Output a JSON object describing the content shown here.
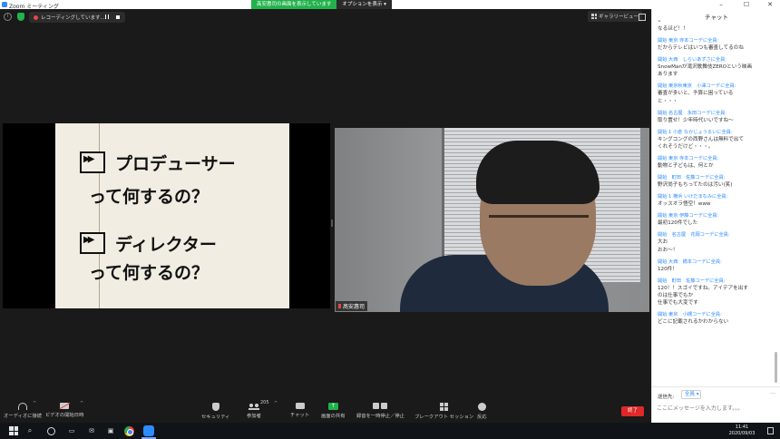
{
  "window": {
    "title": "Zoom ミーティング",
    "minimize": "–",
    "maximize": "☐",
    "close": "✕"
  },
  "share_banner": {
    "status": "髙安惠司の画面を表示しています",
    "view_options": "オプションを表示 ▾"
  },
  "meeting_top": {
    "info_icon": "i",
    "recording_text": "レコーディングしています...",
    "gallery_view": "ギャラリービュー"
  },
  "slide": {
    "heading1": "プロデューサー",
    "sub1": "って何するの？",
    "heading2": "ディレクター",
    "sub2": "って何するの？"
  },
  "participant": {
    "name": "髙安惠司"
  },
  "toolbar": {
    "audio": "オーディオに接続",
    "video": "ビデオの開始日時",
    "security": "セキュリティ",
    "participants": "参加者",
    "participants_count": "205",
    "chat": "チャット",
    "share": "画面の共有",
    "record": "録音を一時停止／停止",
    "breakout": "ブレークアウト セッション",
    "reactions": "反応",
    "end": "終了"
  },
  "chat": {
    "title": "チャット",
    "collapse": "⌄",
    "messages": [
      {
        "sender": "",
        "lines": [
          "なるほど！！"
        ]
      },
      {
        "sender": "開始 東京 寺本コーデに全員:",
        "lines": [
          "だからテレビはいつも審査してるのね"
        ]
      },
      {
        "sender": "開始 大西　しらいあずさに全員:",
        "lines": [
          "SnowManが滝沢歌舞伎ZEROという映画",
          "あります"
        ]
      },
      {
        "sender": "開始 東京秋東京　小澤コーデに全員:",
        "lines": [
          "審査が多いと、予算に困っている",
          "と・・・"
        ]
      },
      {
        "sender": "開始 名古屋　永田コーデに全員:",
        "lines": [
          "取り置せ！少年時代いいですね〜"
        ]
      },
      {
        "sender": "開始 1 小倉 なかじょうるいに全員:",
        "lines": [
          "キングコングの西野さんは無料で出て",
          "くれそうだけど・・・。"
        ]
      },
      {
        "sender": "開始 東京 寺本コーデに全員:",
        "lines": [
          "動物と子どもは、何とか"
        ]
      },
      {
        "sender": "開始　町田　佐藤コーデに全員:",
        "lines": [
          "野沢尚子もちってたのは汚い(笑)"
        ]
      },
      {
        "sender": "開始 1 横浜 いけだまなみに全員:",
        "lines": [
          "オッスオラ悟空！www"
        ]
      },
      {
        "sender": "開始 東京 伊藤コーデに全員:",
        "lines": [
          "最初120件でした"
        ]
      },
      {
        "sender": "開始　名古屋　花岡コーデに全員:",
        "lines": [
          "大お",
          "おお〜！"
        ]
      },
      {
        "sender": "開始 大西　橋本コーデに全員:",
        "lines": [
          "120件！"
        ]
      },
      {
        "sender": "開始　町田　佐藤コーデに全員:",
        "lines": [
          "120！！スゴイですね。アイデアを出す",
          "のは仕事でもか",
          "仕事でも大変です"
        ]
      },
      {
        "sender": "開始 東京　小槻コーデに全員:",
        "lines": [
          "どこに記載されるかわからない"
        ]
      }
    ],
    "to_label": "送信先:",
    "to_value": "全員 ▾",
    "more": "···",
    "input_placeholder": "ここにメッセージを入力します。。。"
  },
  "taskbar": {
    "time": "11:41",
    "date": "2020/09/03",
    "search_glyph": "⌕"
  }
}
